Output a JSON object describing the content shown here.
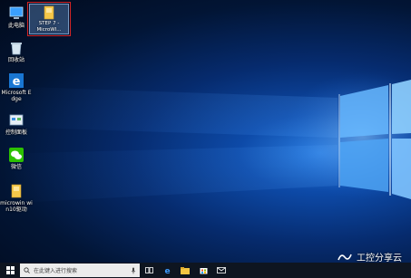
{
  "desktop": {
    "icons": [
      {
        "label": "此电脑",
        "icon": "computer-icon"
      },
      {
        "label": "回收站",
        "icon": "recycle-bin-icon"
      },
      {
        "label": "Microsoft Edge",
        "icon": "edge-icon"
      },
      {
        "label": "控制面板",
        "icon": "control-panel-icon"
      },
      {
        "label": "微信",
        "icon": "wechat-icon"
      },
      {
        "label": "microwin win10驱动",
        "icon": "folder-icon"
      }
    ],
    "selected_icon": {
      "label": "STEP 7 - MicroWI...",
      "icon": "folder-icon"
    }
  },
  "taskbar": {
    "search_placeholder": "在此键入进行搜索",
    "icons": [
      "start-icon",
      "microphone-icon",
      "task-view-icon",
      "edge-icon",
      "file-explorer-icon",
      "store-icon",
      "mail-icon"
    ]
  },
  "watermark": {
    "text": "工控分享云",
    "icon": "wechat-channel-icon"
  },
  "colors": {
    "selection_border": "#d42424",
    "taskbar": "#0e1520",
    "folder": "#f5c84a"
  }
}
